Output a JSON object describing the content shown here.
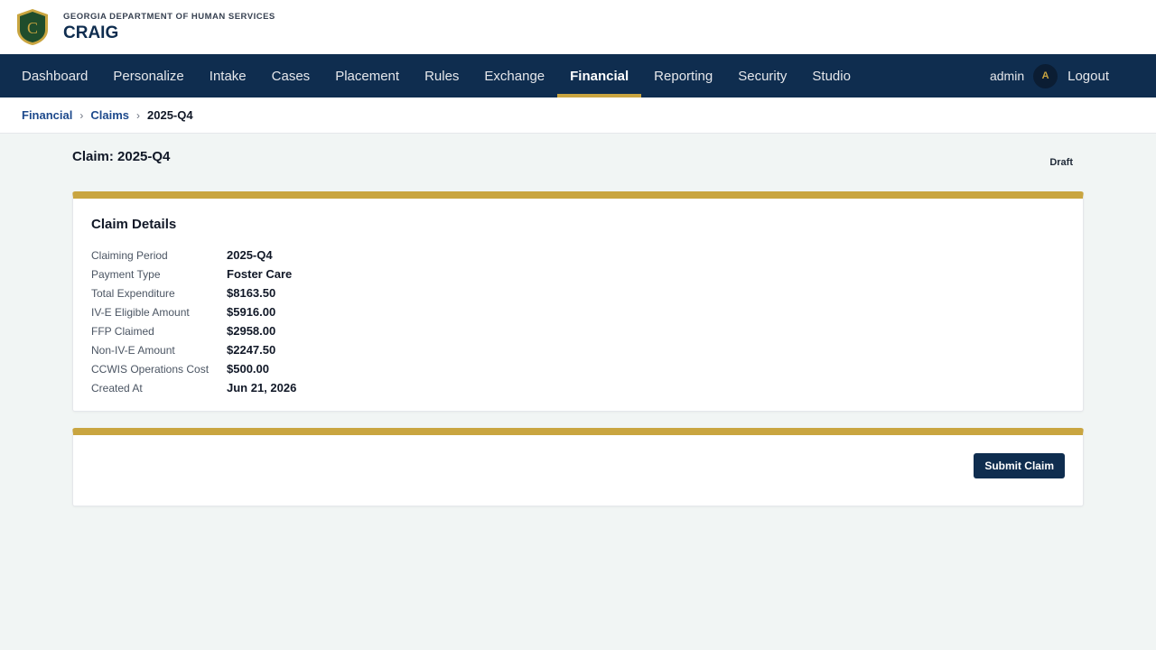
{
  "header": {
    "agency": "GEORGIA DEPARTMENT OF HUMAN SERVICES",
    "app_name": "CRAIG",
    "logo_letter": "C"
  },
  "nav": {
    "items": [
      {
        "label": "Dashboard"
      },
      {
        "label": "Personalize"
      },
      {
        "label": "Intake"
      },
      {
        "label": "Cases"
      },
      {
        "label": "Placement"
      },
      {
        "label": "Rules"
      },
      {
        "label": "Exchange"
      },
      {
        "label": "Financial",
        "active": true
      },
      {
        "label": "Reporting"
      },
      {
        "label": "Security"
      },
      {
        "label": "Studio"
      }
    ],
    "user": "admin",
    "avatar_initial": "A",
    "logout_label": "Logout"
  },
  "breadcrumb": {
    "items": [
      "Financial",
      "Claims"
    ],
    "current": "2025-Q4",
    "separator": "›"
  },
  "page": {
    "title": "Claim: 2025-Q4",
    "status": "Draft"
  },
  "details": {
    "title": "Claim Details",
    "rows": [
      {
        "label": "Claiming Period",
        "value": "2025-Q4"
      },
      {
        "label": "Payment Type",
        "value": "Foster Care"
      },
      {
        "label": "Total Expenditure",
        "value": "$8163.50"
      },
      {
        "label": "IV-E Eligible Amount",
        "value": "$5916.00"
      },
      {
        "label": "FFP Claimed",
        "value": "$2958.00"
      },
      {
        "label": "Non-IV-E Amount",
        "value": "$2247.50"
      },
      {
        "label": "CCWIS Operations Cost",
        "value": "$500.00"
      },
      {
        "label": "Created At",
        "value": "Jun 21, 2026"
      }
    ]
  },
  "actions": {
    "submit_label": "Submit Claim"
  },
  "colors": {
    "navy": "#0f2d4f",
    "gold": "#c9a540",
    "background": "#f1f5f4"
  }
}
